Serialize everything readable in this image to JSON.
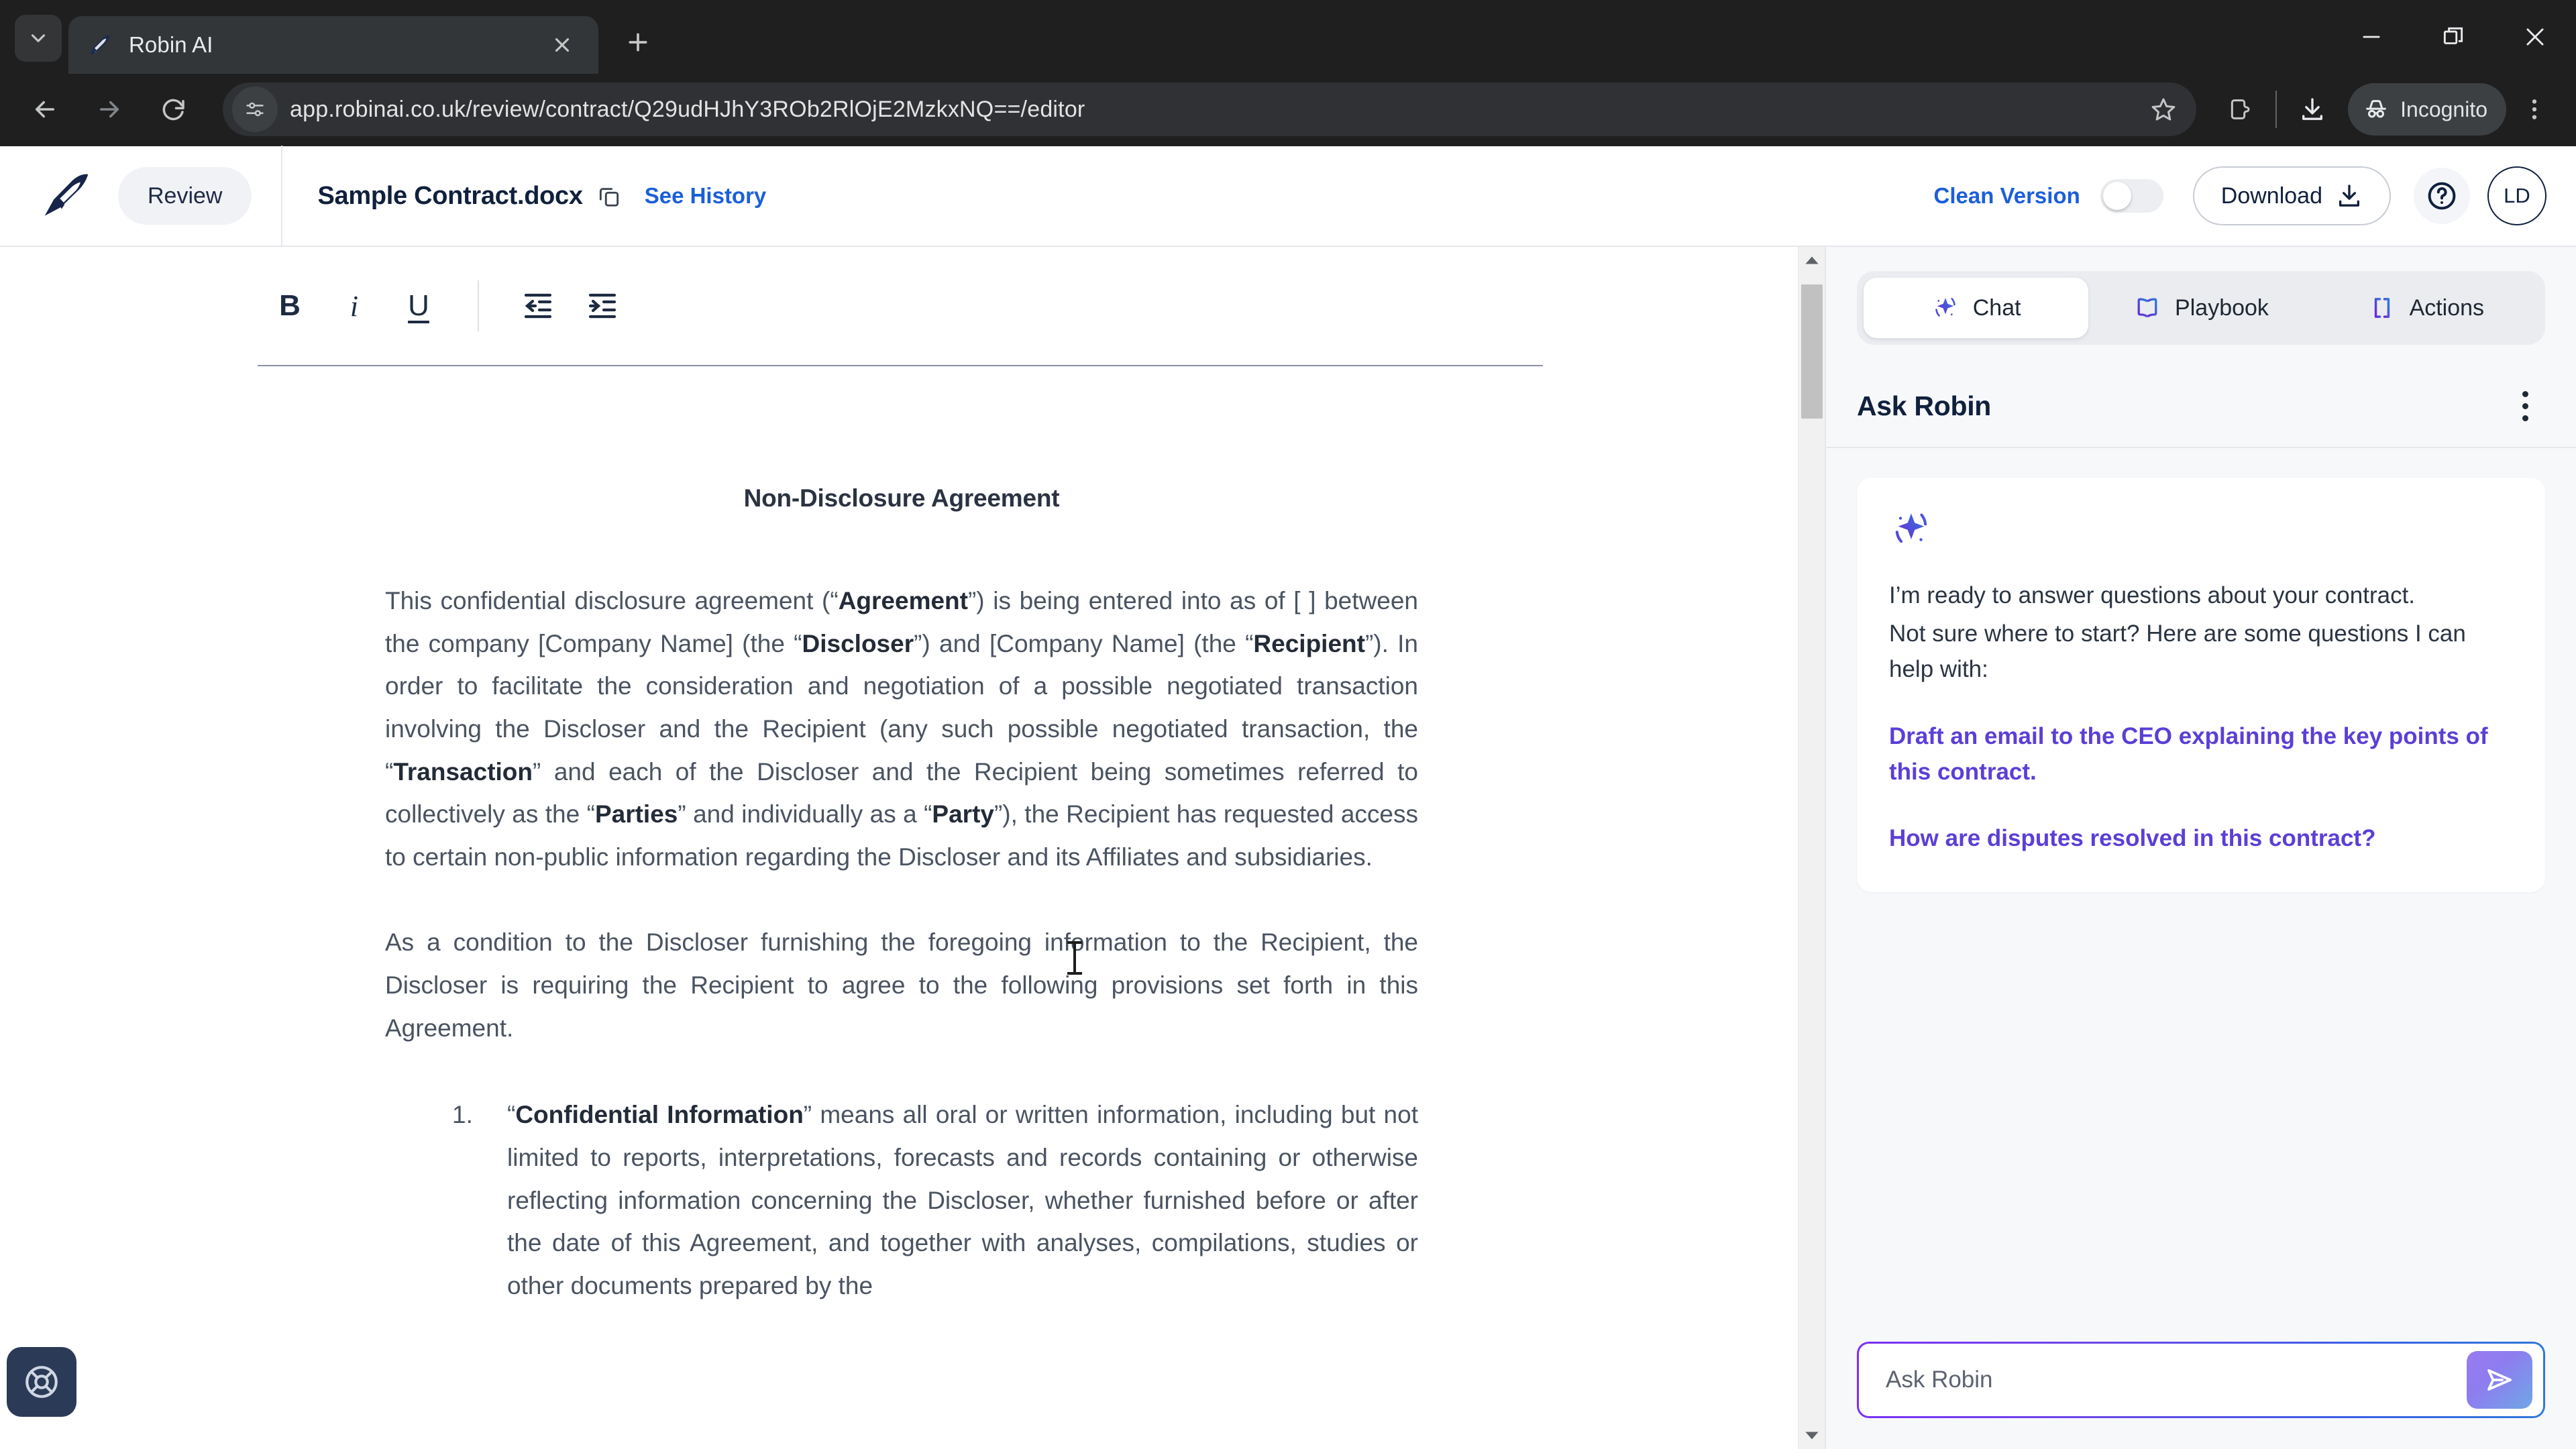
{
  "browser": {
    "tab": {
      "title": "Robin AI",
      "favicon_icon": "robin-bird-icon"
    },
    "tab_search_icon": "chevron-down-icon",
    "new_tab_icon": "plus-icon",
    "window_controls": {
      "minimize": "minimize-icon",
      "maximize": "maximize-icon",
      "close": "close-icon"
    },
    "nav": {
      "back": "back-arrow-icon",
      "forward": "forward-arrow-icon",
      "reload": "reload-icon"
    },
    "omnibox": {
      "site_info_icon": "site-settings-icon",
      "url": "app.robinai.co.uk/review/contract/Q29udHJhY3ROb2RlOjE2MzkxNQ==/editor",
      "bookmark_icon": "star-icon"
    },
    "actions": {
      "extensions_icon": "extensions-icon",
      "downloads_icon": "download-icon",
      "incognito_label": "Incognito",
      "incognito_icon": "incognito-hat-icon",
      "menu_icon": "three-dots-vertical-icon"
    }
  },
  "app_header": {
    "logo_icon": "robin-bird-logo",
    "review_label": "Review",
    "document_title": "Sample Contract.docx",
    "copy_icon": "copy-icon",
    "see_history_label": "See History",
    "clean_version_label": "Clean Version",
    "clean_version_toggle": "off",
    "download_label": "Download",
    "download_icon": "download-icon",
    "help_icon": "question-circle-icon",
    "avatar_initials": "LD"
  },
  "editor_toolbar": {
    "bold_label": "B",
    "italic_label": "i",
    "underline_label": "U",
    "outdent_icon": "outdent-icon",
    "indent_icon": "indent-icon"
  },
  "document": {
    "heading": "Non-Disclosure Agreement",
    "paragraphs": [
      "This confidential disclosure agreement (“Agreement”) is being entered into as of [ ] between the company [Company Name] (the “Discloser”) and [Company Name] (the “Recipient”). In order to facilitate the consideration and negotiation of a possible negotiated transaction involving the Discloser and the Recipient (any such possible negotiated transaction, the “Transaction” and each of the Discloser and the Recipient being sometimes referred to collectively as the “Parties” and individually as a “Party”), the Recipient has requested access to certain non-public information regarding the Discloser and its Affiliates and subsidiaries.",
      "As a condition to the Discloser furnishing the foregoing information to the Recipient, the Discloser is requiring the Recipient to agree to the following provisions set forth in this Agreement."
    ],
    "list_items": [
      {
        "number": "1.",
        "text": "“Confidential Information” means all oral or written information, including but not limited to reports, interpretations, forecasts and records containing or otherwise reflecting information concerning the Discloser, whether furnished before or after the date of this Agreement, and together with analyses, compilations, studies or other documents prepared by the"
      }
    ]
  },
  "chat_panel": {
    "tabs": [
      {
        "label": "Chat",
        "icon": "sparkle-icon",
        "active": true
      },
      {
        "label": "Playbook",
        "icon": "book-icon",
        "active": false
      },
      {
        "label": "Actions",
        "icon": "brackets-icon",
        "active": false
      }
    ],
    "header_title": "Ask Robin",
    "kebab_icon": "three-dots-vertical-icon",
    "message": {
      "avatar_icon": "sparkle-icon",
      "line1": "I’m ready to answer questions about your contract.",
      "line2": "Not sure where to start? Here are some questions I can help with:"
    },
    "suggestions": [
      "Draft an email to the CEO explaining the key points of this contract.",
      "How are disputes resolved in this contract?"
    ],
    "input": {
      "placeholder": "Ask Robin",
      "send_icon": "send-icon"
    }
  },
  "support": {
    "fab_icon": "lifebuoy-icon"
  },
  "colors": {
    "brand_navy": "#10203d",
    "link_blue": "#1b5fd9",
    "suggestion_purple": "#5b3fd6",
    "chrome_dark": "#1f1f1f"
  }
}
